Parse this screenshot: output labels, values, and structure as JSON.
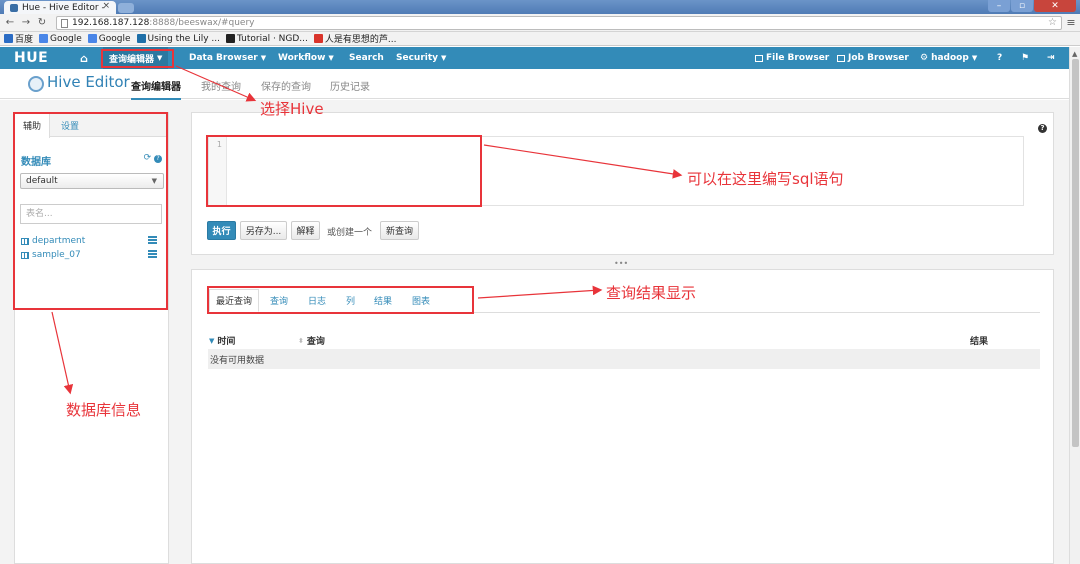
{
  "browser": {
    "tab_title": "Hue - Hive Editor -",
    "tab_close": "×",
    "url_host": "192.168.187.128",
    "url_path": ":8888/beeswax/#query",
    "bookmarks": [
      {
        "label": "百度",
        "color": "#2b6cc4"
      },
      {
        "label": "Google",
        "color": "#4a86e8"
      },
      {
        "label": "Google",
        "color": "#4a86e8"
      },
      {
        "label": "Using the Lily ...",
        "color": "#1e6fa8"
      },
      {
        "label": "Tutorial · NGD...",
        "color": "#222222"
      },
      {
        "label": "人是有思想的芦...",
        "color": "#d9342b"
      }
    ]
  },
  "nav": {
    "logo": "HUE",
    "query_editors": "查询编辑器",
    "data_browser": "Data Browser",
    "workflow": "Workflow",
    "search": "Search",
    "security": "Security",
    "file_browser": "File Browser",
    "job_browser": "Job Browser",
    "user": "hadoop",
    "help": "?",
    "flag": "⚑",
    "logout": "⇥"
  },
  "app": {
    "title": "Hive Editor",
    "subnav": [
      "查询编辑器",
      "我的查询",
      "保存的查询",
      "历史记录"
    ]
  },
  "sidebar": {
    "tabs": [
      "辅助",
      "设置"
    ],
    "db_label": "数据库",
    "refresh_icon": "⟳",
    "help_icon": "?",
    "database": "default",
    "table_filter_placeholder": "表名...",
    "tables": [
      "department",
      "sample_07"
    ]
  },
  "editor": {
    "line_number": "1",
    "help": "?",
    "buttons": {
      "execute": "执行",
      "save_as": "另存为...",
      "explain": "解释",
      "or_create": "或创建一个",
      "new_query": "新查询"
    }
  },
  "results": {
    "tabs": [
      "最近查询",
      "查询",
      "日志",
      "列",
      "结果",
      "图表"
    ],
    "columns": [
      "时间",
      "查询",
      "结果"
    ],
    "empty_message": "没有可用数据"
  },
  "annotations": {
    "select_hive": "选择Hive",
    "write_sql": "可以在这里编写sql语句",
    "query_results": "查询结果显示",
    "db_info": "数据库信息",
    "color": "#e8343a"
  }
}
